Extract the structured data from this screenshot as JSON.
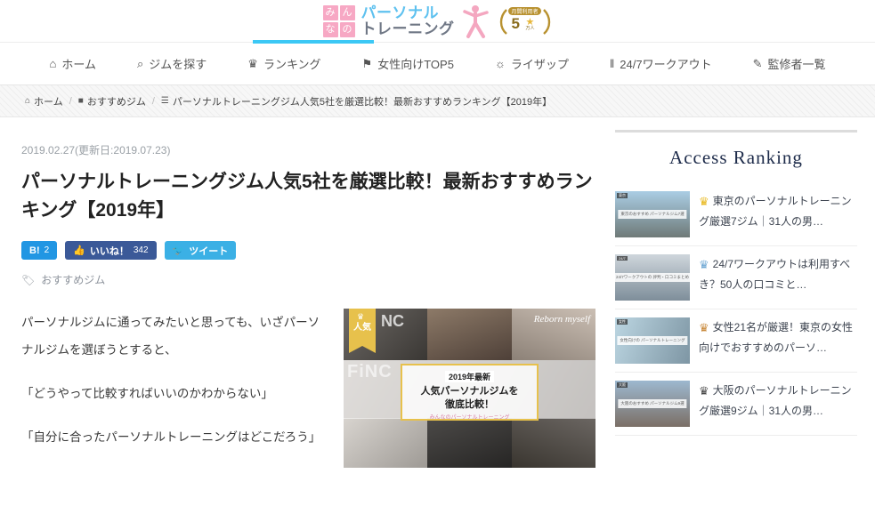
{
  "header": {
    "logo": {
      "kana": [
        "み",
        "ん",
        "な",
        "の"
      ],
      "line1": "パーソナル",
      "line2": "トレーニング",
      "badge_top": "月間利用者",
      "badge_num": "5",
      "badge_star": "★",
      "badge_unit": "万人"
    },
    "accent_color": "#3cc8f5"
  },
  "nav": {
    "items": [
      {
        "icon": "home-icon",
        "glyph": "⌂",
        "label": "ホーム"
      },
      {
        "icon": "search-icon",
        "glyph": "⌕",
        "label": "ジムを探す"
      },
      {
        "icon": "crown-icon",
        "glyph": "♛",
        "label": "ランキング"
      },
      {
        "icon": "flag-icon",
        "glyph": "⚑",
        "label": "女性向けTOP5"
      },
      {
        "icon": "comment-icon",
        "glyph": "☼",
        "label": "ライザップ"
      },
      {
        "icon": "dumbbell-icon",
        "glyph": "‖",
        "label": "24/7ワークアウト"
      },
      {
        "icon": "pencil-icon",
        "glyph": "✎",
        "label": "監修者一覧"
      }
    ]
  },
  "breadcrumb": {
    "items": [
      {
        "icon": "home-icon",
        "glyph": "⌂",
        "label": "ホーム"
      },
      {
        "icon": "folder-icon",
        "glyph": "■",
        "label": "おすすめジム"
      },
      {
        "icon": "document-icon",
        "glyph": "☰",
        "label": "パーソナルトレーニングジム人気5社を厳選比較！最新おすすめランキング【2019年】"
      }
    ],
    "separator": "/"
  },
  "article": {
    "date": "2019.02.27(更新日:2019.07.23)",
    "title": "パーソナルトレーニングジム人気5社を厳選比較！最新おすすめランキング【2019年】",
    "share": {
      "hatena_label": "B!",
      "hatena_count": "2",
      "facebook_label": "いいね！",
      "facebook_count": "342",
      "twitter_label": "ツイート",
      "hatena_color": "#2196e3",
      "facebook_color": "#3b5998",
      "twitter_color": "#3bb0e5"
    },
    "tag": "おすすめジム",
    "paragraphs": [
      "パーソナルジムに通ってみたいと思っても、いざパーソナルジムを選ぼうとすると、",
      "「どうやって比較すればいいのかわからない」",
      "「自分に合ったパーソナルトレーニングはどこだろう」"
    ],
    "image": {
      "ribbon_label": "人気",
      "caption_year": "2019年最新",
      "caption_line1": "人気パーソナルジムを",
      "caption_line2": "徹底比較！",
      "caption_brand": "みんなのパーソナルトレーニング",
      "watermark_fing": "FiNC",
      "watermark_nc": "NC",
      "watermark_reborn": "Reborn myself"
    }
  },
  "sidebar": {
    "ranking_title": "Access Ranking",
    "items": [
      {
        "crown": "crown-icon",
        "rank": "1",
        "text": "東京のパーソナルトレーニング厳選7ジム｜31人の男…",
        "thumb_label": "東京",
        "thumb_caption": "東京のおすすめ\nパーソナルジム7選"
      },
      {
        "crown": "crown-icon",
        "rank": "2",
        "text": "24/7ワークアウトは利用すべき？50人の口コミと…",
        "thumb_label": "24/7",
        "thumb_caption": "24/7ワークアウトの\n評判・口コミまとめ"
      },
      {
        "crown": "crown-icon",
        "rank": "3",
        "text": "女性21名が厳選！東京の女性向けでおすすめのパーソ…",
        "thumb_label": "女性",
        "thumb_caption": "女性向けの\nパーソナルトレーニング"
      },
      {
        "crown": "crown-icon",
        "rank": "4",
        "text": "大阪のパーソナルトレーニング厳選9ジム｜31人の男…",
        "thumb_label": "大阪",
        "thumb_caption": "大阪のおすすめ\nパーソナルジム9選"
      }
    ]
  }
}
